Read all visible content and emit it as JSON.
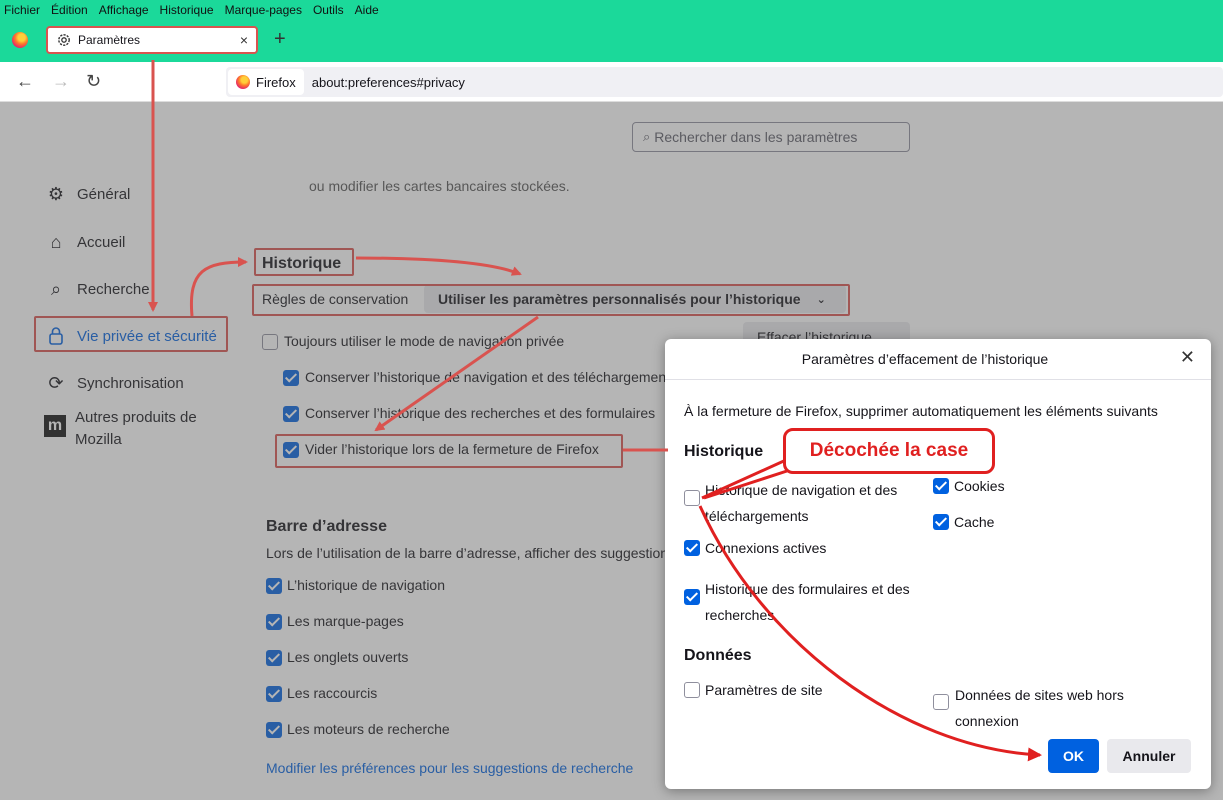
{
  "menu": [
    "Fichier",
    "Édition",
    "Affichage",
    "Historique",
    "Marque-pages",
    "Outils",
    "Aide"
  ],
  "tab": {
    "title": "Paramètres",
    "close": "×",
    "new_tab": "+"
  },
  "navbar": {
    "identity": "Firefox",
    "url": "about:preferences#privacy",
    "back": "←",
    "forward": "→",
    "reload": "↻"
  },
  "search": {
    "placeholder": "Rechercher dans les paramètres"
  },
  "sidebar": {
    "items": [
      {
        "label": "Général",
        "icon": "gear-icon"
      },
      {
        "label": "Accueil",
        "icon": "home-icon"
      },
      {
        "label": "Recherche",
        "icon": "search-icon"
      },
      {
        "label": "Vie privée et sécurité",
        "icon": "lock-icon"
      },
      {
        "label": "Synchronisation",
        "icon": "sync-icon"
      },
      {
        "label": "Autres produits de\nMozilla",
        "icon": "mozilla-icon"
      }
    ]
  },
  "content": {
    "saved_cards_text": "ou modifier les cartes bancaires stockées.",
    "history_heading": "Historique",
    "retention_label": "Règles de conservation",
    "retention_value": "Utiliser les paramètres personnalisés pour l’historique",
    "always_private": "Toujours utiliser le mode de navigation privée",
    "keep_nav_history": "Conserver l’historique de navigation et des téléchargements",
    "keep_search_history": "Conserver l’historique des recherches et des formulaires",
    "clear_on_close": "Vider l’historique lors de la fermeture de Firefox",
    "clear_history_button": "Effacer l’historique…",
    "address_bar_heading": "Barre d’adresse",
    "address_bar_desc": "Lors de l’utilisation de la barre d’adresse, afficher des suggestions",
    "suggestions": [
      "L’historique de navigation",
      "Les marque-pages",
      "Les onglets ouverts",
      "Les raccourcis",
      "Les moteurs de recherche"
    ],
    "modify_link": "Modifier les préférences pour les suggestions de recherche"
  },
  "dialog": {
    "title": "Paramètres d’effacement de l’historique",
    "intro": "À la fermeture de Firefox, supprimer automatiquement les éléments suivants",
    "history_heading": "Historique",
    "items": {
      "nav_history": "Historique de navigation et des\ntéléchargements",
      "cookies": "Cookies",
      "cache": "Cache",
      "active_logins": "Connexions actives",
      "form_history": "Historique des formulaires et des\nrecherches"
    },
    "data_heading": "Données",
    "data_items": {
      "site_settings": "Paramètres de site",
      "offline_data": "Données de sites web hors\nconnexion"
    },
    "ok": "OK",
    "cancel": "Annuler"
  },
  "callout": {
    "text": "Décochée la case"
  },
  "colors": {
    "accent": "#0061e0",
    "annotation_red": "#e02020",
    "tabstrip": "#1bd99a"
  }
}
